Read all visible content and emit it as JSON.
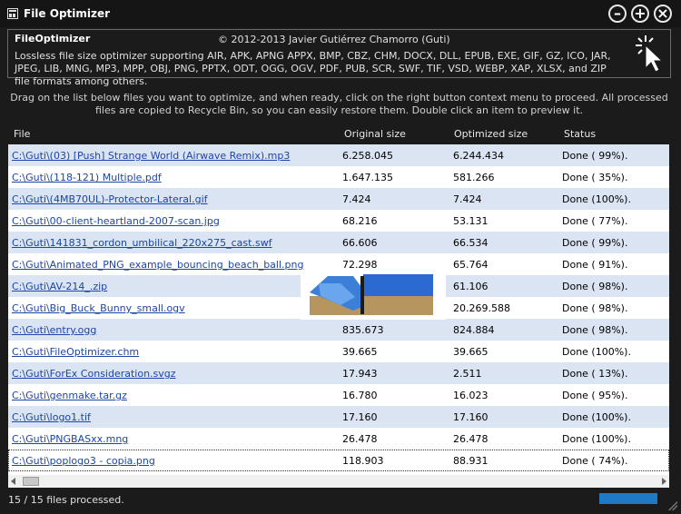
{
  "window": {
    "title": "File Optimizer"
  },
  "info": {
    "app_name": "FileOptimizer",
    "copyright": "© 2012-2013 Javier Gutiérrez Chamorro (Guti)",
    "description": "Lossless file size optimizer supporting AIR, APK, APNG APPX, BMP, CBZ, CHM, DOCX, DLL, EPUB, EXE, GIF, GZ, ICO, JAR, JPEG, LIB, MNG, MP3, MPP, OBJ, PNG, PPTX, ODT, OGG, OGV, PDF, PUB, SCR, SWF, TIF, VSD, WEBP, XAP, XLSX, and ZIP file formats among others."
  },
  "instructions": "Drag on the list below files you want to optimize, and when ready, click on the right button context menu to proceed. All processed files are copied to Recycle Bin, so you can easily restore them. Double click an item to preview it.",
  "columns": [
    "File",
    "Original size",
    "Optimized size",
    "Status"
  ],
  "rows": [
    {
      "file": "C:\\Guti\\(03) [Push] Strange World (Airwave Remix).mp3",
      "original": "6.258.045",
      "optimized": "6.244.434",
      "status": "Done ( 99%)."
    },
    {
      "file": "C:\\Guti\\(118-121) Multiple.pdf",
      "original": "1.647.135",
      "optimized": "581.266",
      "status": "Done ( 35%)."
    },
    {
      "file": "C:\\Guti\\(4MB70UL)-Protector-Lateral.gif",
      "original": "7.424",
      "optimized": "7.424",
      "status": "Done (100%)."
    },
    {
      "file": "C:\\Guti\\00-client-heartland-2007-scan.jpg",
      "original": "68.216",
      "optimized": "53.131",
      "status": "Done ( 77%)."
    },
    {
      "file": "C:\\Guti\\141831_cordon_umbilical_220x275_cast.swf",
      "original": "66.606",
      "optimized": "66.534",
      "status": "Done ( 99%)."
    },
    {
      "file": "C:\\Guti\\Animated_PNG_example_bouncing_beach_ball.png",
      "original": "72.298",
      "optimized": "65.764",
      "status": "Done ( 91%)."
    },
    {
      "file": "C:\\Guti\\AV-214_.zip",
      "original": "",
      "optimized": "61.106",
      "status": "Done ( 98%)."
    },
    {
      "file": "C:\\Guti\\Big_Buck_Bunny_small.ogv",
      "original": "",
      "optimized": "20.269.588",
      "status": "Done ( 98%)."
    },
    {
      "file": "C:\\Guti\\entry.ogg",
      "original": "835.673",
      "optimized": "824.884",
      "status": "Done ( 98%)."
    },
    {
      "file": "C:\\Guti\\FileOptimizer.chm",
      "original": "39.665",
      "optimized": "39.665",
      "status": "Done (100%)."
    },
    {
      "file": "C:\\Guti\\ForEx Consideration.svgz",
      "original": "17.943",
      "optimized": "2.511",
      "status": "Done ( 13%)."
    },
    {
      "file": "C:\\Guti\\genmake.tar.gz",
      "original": "16.780",
      "optimized": "16.023",
      "status": "Done ( 95%)."
    },
    {
      "file": "C:\\Guti\\logo1.tif",
      "original": "17.160",
      "optimized": "17.160",
      "status": "Done (100%)."
    },
    {
      "file": "C:\\Guti\\PNGBASxx.mng",
      "original": "26.478",
      "optimized": "26.478",
      "status": "Done (100%)."
    },
    {
      "file": "C:\\Guti\\poplogo3 - copia.png",
      "original": "118.903",
      "optimized": "88.931",
      "status": "Done ( 74%)."
    }
  ],
  "status_bar": {
    "text": "15 / 15 files processed.",
    "progress": 1.0
  },
  "icons": {
    "minimize": "minus-circle-icon",
    "add": "plus-circle-icon",
    "close": "close-circle-icon",
    "cursor": "click-cursor-icon"
  },
  "colors": {
    "link": "#1b45a8",
    "row_alt": "#dae4f2",
    "progress": "#1e7ac7"
  }
}
